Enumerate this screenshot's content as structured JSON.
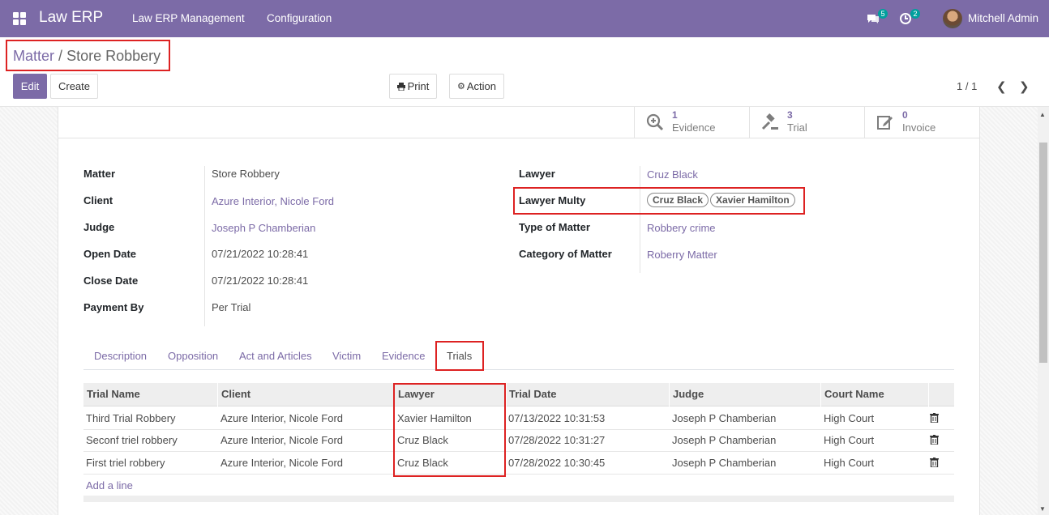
{
  "navbar": {
    "brand": "Law ERP",
    "menu": [
      "Law ERP Management",
      "Configuration"
    ],
    "messages_count": "5",
    "activities_count": "2",
    "user_name": "Mitchell Admin"
  },
  "breadcrumb": {
    "parent": "Matter",
    "separator": "/",
    "current": "Store Robbery"
  },
  "toolbar": {
    "edit_label": "Edit",
    "create_label": "Create",
    "print_label": "Print",
    "action_label": "Action"
  },
  "pager": {
    "value": "1 / 1"
  },
  "smart_buttons": [
    {
      "count": "1",
      "label": "Evidence",
      "icon": "search-plus-icon"
    },
    {
      "count": "3",
      "label": "Trial",
      "icon": "gavel-icon"
    },
    {
      "count": "0",
      "label": "Invoice",
      "icon": "edit-icon"
    }
  ],
  "fields_left": [
    {
      "label": "Matter",
      "value": "Store Robbery",
      "link": false
    },
    {
      "label": "Client",
      "value": "Azure Interior, Nicole Ford",
      "link": true
    },
    {
      "label": "Judge",
      "value": "Joseph P Chamberian",
      "link": true
    },
    {
      "label": "Open Date",
      "value": "07/21/2022 10:28:41",
      "link": false
    },
    {
      "label": "Close Date",
      "value": "07/21/2022 10:28:41",
      "link": false
    },
    {
      "label": "Payment By",
      "value": "Per Trial",
      "link": false
    }
  ],
  "fields_right": {
    "lawyer": {
      "label": "Lawyer",
      "value": "Cruz Black"
    },
    "lawyer_multy": {
      "label": "Lawyer Multy",
      "tags": [
        "Cruz Black",
        "Xavier Hamilton"
      ]
    },
    "type_of_matter": {
      "label": "Type of Matter",
      "value": "Robbery crime"
    },
    "category_of_matter": {
      "label": "Category of Matter",
      "value": "Roberry Matter"
    }
  },
  "tabs": [
    "Description",
    "Opposition",
    "Act and Articles",
    "Victim",
    "Evidence",
    "Trials"
  ],
  "active_tab": "Trials",
  "table": {
    "headers": [
      "Trial Name",
      "Client",
      "Lawyer",
      "Trial Date",
      "Judge",
      "Court Name"
    ],
    "rows": [
      [
        "Third Trial Robbery",
        "Azure Interior, Nicole Ford",
        "Xavier Hamilton",
        "07/13/2022 10:31:53",
        "Joseph P Chamberian",
        "High Court"
      ],
      [
        "Seconf triel robbery",
        "Azure Interior, Nicole Ford",
        "Cruz Black",
        "07/28/2022 10:31:27",
        "Joseph P Chamberian",
        "High Court"
      ],
      [
        "First triel robbery",
        "Azure Interior, Nicole Ford",
        "Cruz Black",
        "07/28/2022 10:30:45",
        "Joseph P Chamberian",
        "High Court"
      ]
    ],
    "add_line": "Add a line"
  },
  "colors": {
    "navbar": "#7c6ba7",
    "highlight": "#dd2222",
    "link": "#7c6ba7"
  }
}
